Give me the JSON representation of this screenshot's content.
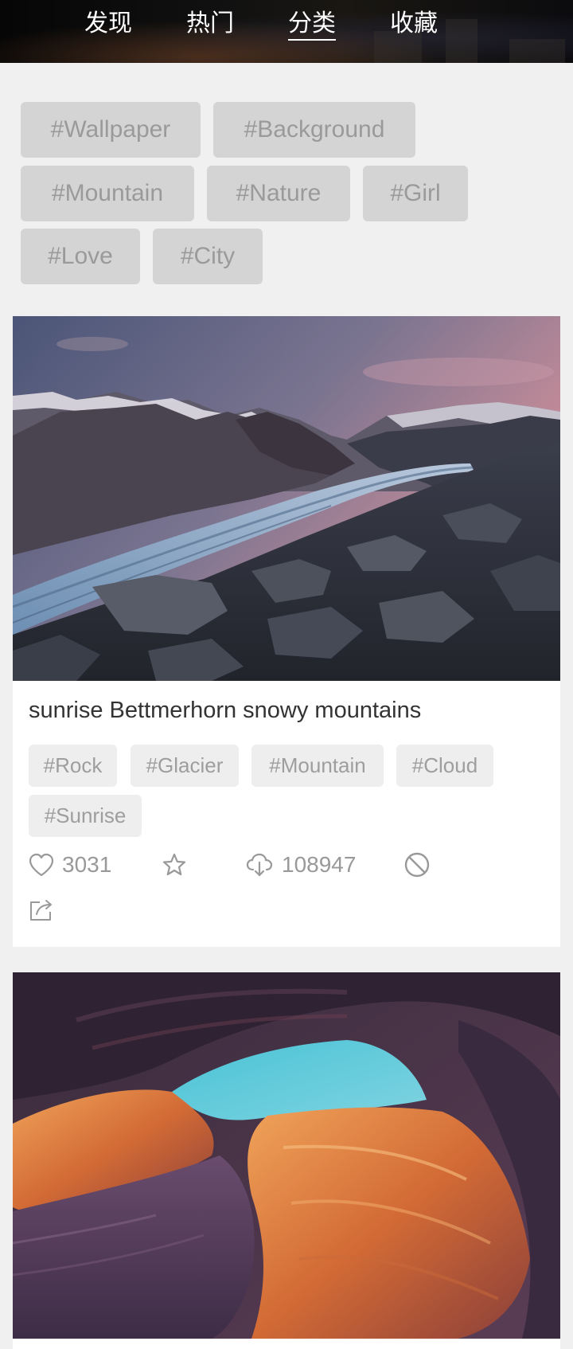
{
  "tabs": [
    {
      "label": "发现"
    },
    {
      "label": "热门"
    },
    {
      "label": "分类",
      "active": true
    },
    {
      "label": "收藏"
    }
  ],
  "categories": [
    "#Wallpaper",
    "#Background",
    "#Mountain",
    "#Nature",
    "#Girl",
    "#Love",
    "#City"
  ],
  "cards": [
    {
      "title": "sunrise Bettmerhorn snowy mountains",
      "tags": [
        "#Rock",
        "#Glacier",
        "#Mountain",
        "#Cloud",
        "#Sunrise"
      ],
      "likes": "3031",
      "downloads": "108947",
      "icons": [
        "heart-icon",
        "star-icon",
        "cloud-download-icon",
        "block-icon",
        "share-icon"
      ]
    },
    {
      "image": "antelope-canyon"
    }
  ],
  "colors": {
    "background": "#f0f0f0",
    "tag_bg": "#d4d4d4",
    "tag_text": "#9a9a9a",
    "chip_bg": "#eeeeee",
    "title_text": "#333333",
    "meta_text": "#999999"
  }
}
